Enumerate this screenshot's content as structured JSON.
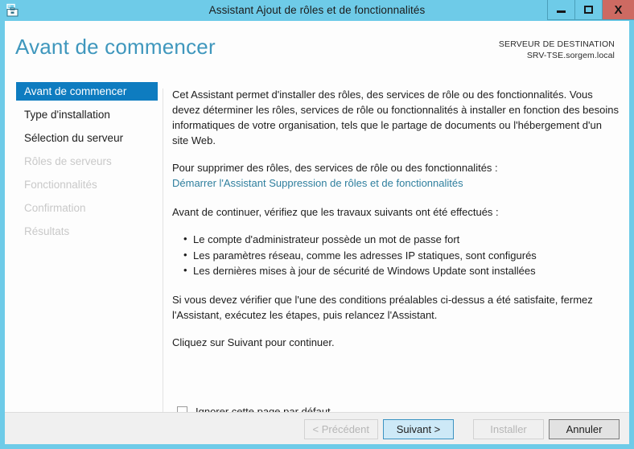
{
  "window": {
    "title": "Assistant Ajout de rôles et de fonctionnalités",
    "icon": "server-wizard-icon",
    "controls": {
      "minimize": "–",
      "maximize": "□",
      "close": "X"
    },
    "colors": {
      "titlebar": "#6ecbe8",
      "close_button": "#cd6a62",
      "accent": "#0e7cc0",
      "heading": "#3f97bd",
      "link": "#2f7f9e",
      "footer": "#f0f0f0"
    }
  },
  "header": {
    "title": "Avant de commencer",
    "destination_label": "SERVEUR DE DESTINATION",
    "destination_server": "SRV-TSE.sorgem.local"
  },
  "sidebar": {
    "items": [
      {
        "label": "Avant de commencer",
        "state": "selected"
      },
      {
        "label": "Type d'installation",
        "state": "enabled"
      },
      {
        "label": "Sélection du serveur",
        "state": "enabled"
      },
      {
        "label": "Rôles de serveurs",
        "state": "disabled"
      },
      {
        "label": "Fonctionnalités",
        "state": "disabled"
      },
      {
        "label": "Confirmation",
        "state": "disabled"
      },
      {
        "label": "Résultats",
        "state": "disabled"
      }
    ]
  },
  "content": {
    "intro": "Cet Assistant permet d'installer des rôles, des services de rôle ou des fonctionnalités. Vous devez déterminer les rôles, services de rôle ou fonctionnalités à installer en fonction des besoins informatiques de votre organisation, tels que le partage de documents ou l'hébergement d'un site Web.",
    "remove_intro": "Pour supprimer des rôles, des services de rôle ou des fonctionnalités :",
    "remove_link": "Démarrer l'Assistant Suppression de rôles et de fonctionnalités",
    "checklist_intro": "Avant de continuer, vérifiez que les travaux suivants ont été effectués :",
    "checklist": [
      "Le compte d'administrateur possède un mot de passe fort",
      "Les paramètres réseau, comme les adresses IP statiques, sont configurés",
      "Les dernières mises à jour de sécurité de Windows Update sont installées"
    ],
    "prereq_note": "Si vous devez vérifier que l'une des conditions préalables ci-dessus a été satisfaite, fermez l'Assistant, exécutez les étapes, puis relancez l'Assistant.",
    "continue_note": "Cliquez sur Suivant pour continuer.",
    "skip_checkbox_label": "Ignorer cette page par défaut",
    "skip_checkbox_checked": false
  },
  "footer": {
    "buttons": [
      {
        "label": "< Précédent",
        "state": "disabled"
      },
      {
        "label": "Suivant >",
        "state": "default"
      },
      {
        "label": "Installer",
        "state": "disabled"
      },
      {
        "label": "Annuler",
        "state": "enabled"
      }
    ]
  }
}
